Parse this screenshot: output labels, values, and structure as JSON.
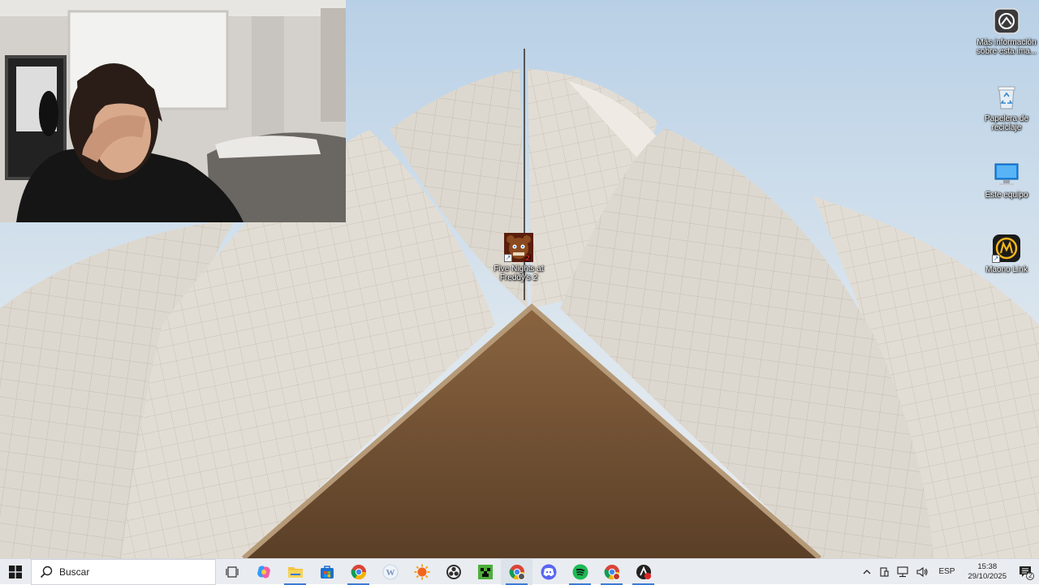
{
  "desktop": {
    "icons": [
      {
        "label": "Más información sobre esta ima...",
        "icon": "camera-info-icon"
      },
      {
        "label": "Papelera de reciclaje",
        "icon": "recycle-bin-icon"
      },
      {
        "label": "Este equipo",
        "icon": "computer-icon"
      },
      {
        "label": "Maono Link",
        "icon": "maono-link-icon"
      },
      {
        "label": "Five Nights at Freddy's 2",
        "icon": "fnaf2-game-icon"
      }
    ]
  },
  "taskbar": {
    "search_placeholder": "Buscar",
    "apps": [
      {
        "name": "Task View",
        "icon": "task-view-icon"
      },
      {
        "name": "Copilot",
        "icon": "copilot-icon"
      },
      {
        "name": "File Explorer",
        "icon": "file-explorer-icon"
      },
      {
        "name": "Microsoft Store",
        "icon": "store-icon"
      },
      {
        "name": "Google Chrome",
        "icon": "chrome-icon"
      },
      {
        "name": "Wordament",
        "icon": "word-app-icon"
      },
      {
        "name": "Orange app",
        "icon": "sun-app-icon"
      },
      {
        "name": "OBS Studio",
        "icon": "obs-icon"
      },
      {
        "name": "Minecraft",
        "icon": "minecraft-icon"
      },
      {
        "name": "Google Chrome profile",
        "icon": "chrome-profile-icon"
      },
      {
        "name": "Discord",
        "icon": "discord-icon"
      },
      {
        "name": "Spotify",
        "icon": "spotify-icon"
      },
      {
        "name": "Chrome (other profile)",
        "icon": "chrome-profile2-icon"
      },
      {
        "name": "Recording app",
        "icon": "record-app-icon"
      }
    ],
    "tray": {
      "language": "ESP",
      "time": "15:38",
      "date": "29/10/2025",
      "notification_count": "2"
    }
  },
  "colors": {
    "taskbar_bg": "#e9ecf0",
    "accent": "#3a7bd5"
  }
}
